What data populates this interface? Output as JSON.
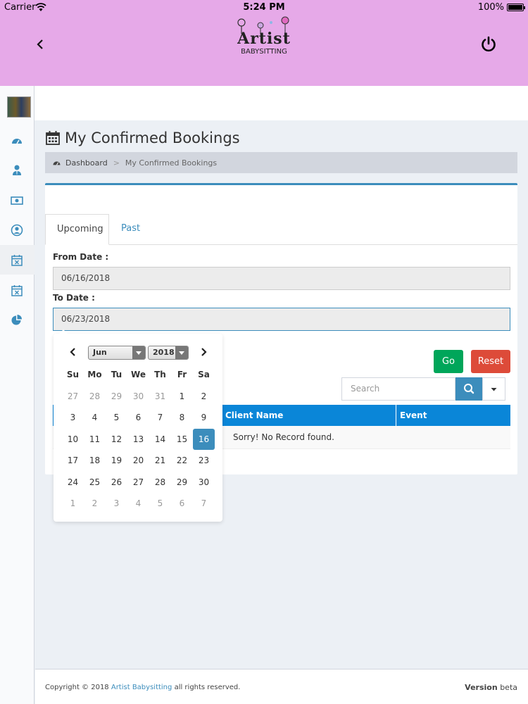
{
  "status_bar": {
    "carrier": "Carrier",
    "time": "5:24 PM",
    "battery": "100%"
  },
  "header": {
    "logo_line1": "Artist",
    "logo_line2": "BABYSITTING",
    "brand_color": "#e6a9e8"
  },
  "sidebar": {
    "items": [
      {
        "icon": "dashboard-icon"
      },
      {
        "icon": "user-tie-icon"
      },
      {
        "icon": "money-icon"
      },
      {
        "icon": "user-circle-icon"
      },
      {
        "icon": "calendar-times-icon",
        "active": true
      },
      {
        "icon": "calendar-times-icon"
      },
      {
        "icon": "pie-chart-icon"
      }
    ]
  },
  "page": {
    "title": "My Confirmed Bookings",
    "breadcrumb_home": "Dashboard",
    "breadcrumb_separator": ">",
    "breadcrumb_current": "My Confirmed Bookings"
  },
  "tabs": [
    {
      "label": "Upcoming",
      "active": true
    },
    {
      "label": "Past",
      "active": false
    }
  ],
  "filters": {
    "from_label": "From Date :",
    "from_value": "06/16/2018",
    "to_label": "To Date :",
    "to_value": "06/23/2018",
    "go_label": "Go",
    "reset_label": "Reset"
  },
  "search": {
    "placeholder": "Search"
  },
  "table": {
    "columns": [
      "Client Name",
      "Event"
    ],
    "empty_message": "Sorry! No Record found."
  },
  "datepicker": {
    "month": "Jun",
    "year": "2018",
    "weekdays": [
      "Su",
      "Mo",
      "Tu",
      "We",
      "Th",
      "Fr",
      "Sa"
    ],
    "weeks": [
      [
        "27",
        "28",
        "29",
        "30",
        "31",
        "1",
        "2"
      ],
      [
        "3",
        "4",
        "5",
        "6",
        "7",
        "8",
        "9"
      ],
      [
        "10",
        "11",
        "12",
        "13",
        "14",
        "15",
        "16"
      ],
      [
        "17",
        "18",
        "19",
        "20",
        "21",
        "22",
        "23"
      ],
      [
        "24",
        "25",
        "26",
        "27",
        "28",
        "29",
        "30"
      ],
      [
        "1",
        "2",
        "3",
        "4",
        "5",
        "6",
        "7"
      ]
    ],
    "selected_day": "16"
  },
  "footer": {
    "copyright": "Copyright © 2018",
    "brand_link": "Artist Babysitting",
    "rights": "all rights reserved.",
    "version_label": "Version",
    "version_value": "beta"
  },
  "colors": {
    "primary": "#3c8dbc",
    "table_header": "#0a86d8",
    "success": "#00a65a",
    "danger": "#dd4b39"
  }
}
